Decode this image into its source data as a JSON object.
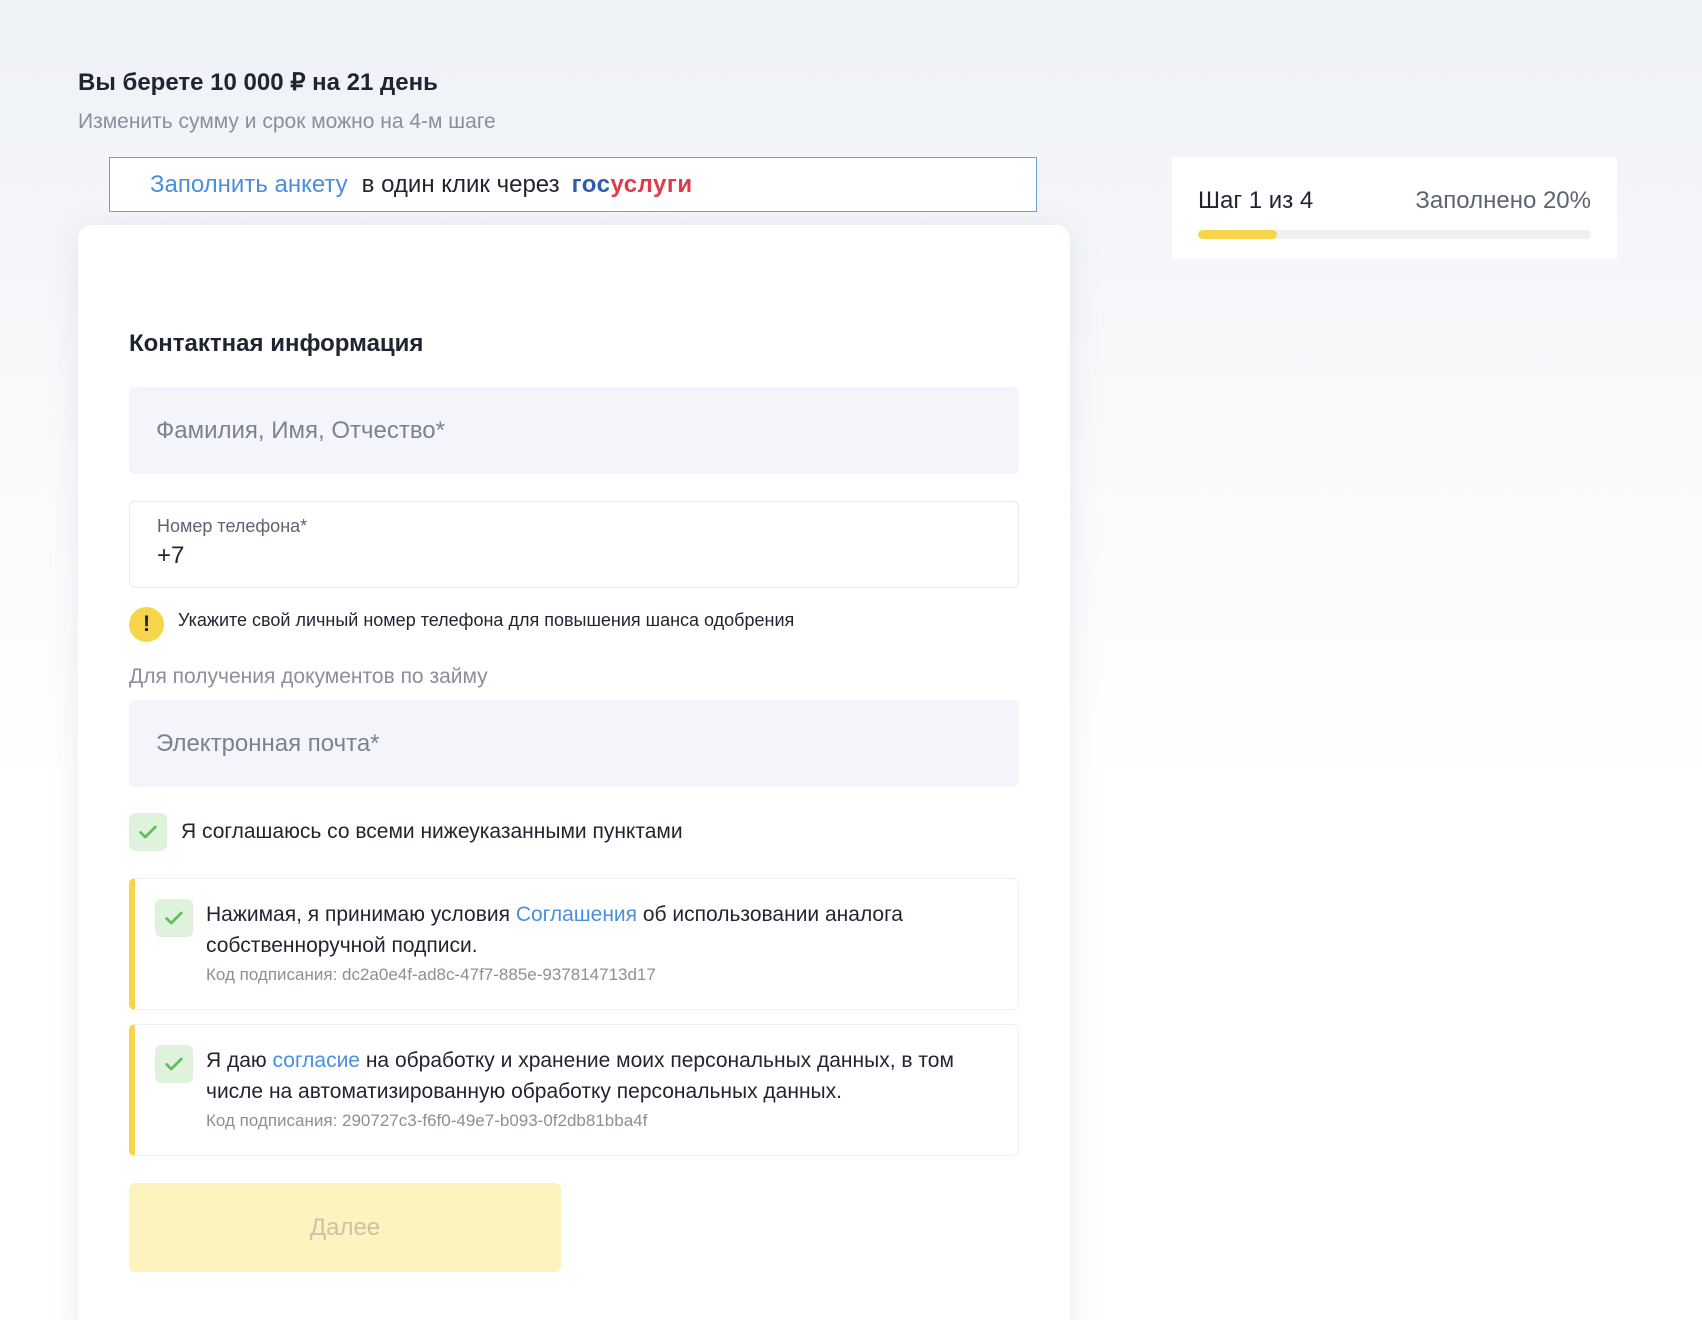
{
  "header": {
    "loan_title": "Вы берете 10 000 ₽ на 21 день",
    "loan_subtitle": "Изменить сумму и срок можно на 4-м шаге"
  },
  "gosuslugi_banner": {
    "link_text": "Заполнить анкету",
    "middle_text": "в один клик через",
    "logo_part1": "гос",
    "logo_part2": "услуги"
  },
  "form": {
    "section_title": "Контактная информация",
    "fio_placeholder": "Фамилия, Имя, Отчество*",
    "phone_label": "Номер телефона*",
    "phone_value": "+7",
    "phone_hint": "Укажите свой личный номер телефона для повышения шанса одобрения",
    "docs_label": "Для получения документов по займу",
    "email_placeholder": "Электронная почта*",
    "agree_all_label": "Я соглашаюсь со всеми нижеуказанными пунктами",
    "consents": [
      {
        "text_before": "Нажимая, я принимаю условия ",
        "link": "Соглашения",
        "text_after": " об использовании аналога собственноручной подписи.",
        "code": "Код подписания: dc2a0e4f-ad8c-47f7-885e-937814713d17",
        "checked": true
      },
      {
        "text_before": "Я даю ",
        "link": "согласие",
        "text_after": " на обработку и хранение моих персональных данных, в том числе на автоматизированную обработку персональных данных.",
        "code": "Код подписания: 290727c3-f6f0-49e7-b093-0f2db81bba4f",
        "checked": true
      }
    ],
    "next_button": "Далее"
  },
  "progress": {
    "step_text": "Шаг 1 из 4",
    "filled_text": "Заполнено 20%",
    "percent": 20
  },
  "colors": {
    "accent_yellow": "#f7d54a",
    "link_blue": "#4a8ee0",
    "check_green": "#5cbf5a"
  }
}
